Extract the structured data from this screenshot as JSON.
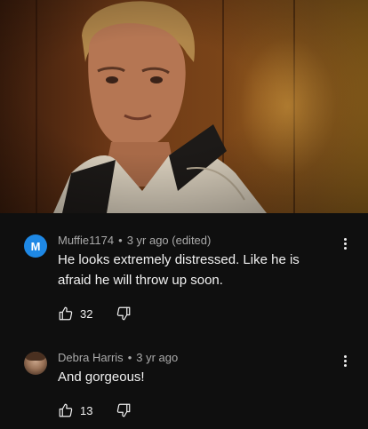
{
  "video_frame": {
    "description_icon": "movie-still"
  },
  "comments": [
    {
      "avatar_letter": "M",
      "avatar_color": "#1e88e5",
      "author": "Muffie1174",
      "separator": "•",
      "time": "3 yr ago (edited)",
      "text": "He looks extremely distressed. Like he is afraid he will throw up soon.",
      "likes": "32"
    },
    {
      "avatar_letter": "",
      "author": "Debra Harris",
      "separator": "•",
      "time": "3 yr ago",
      "text": "And gorgeous!",
      "likes": "13"
    }
  ],
  "icons": {
    "like": "thumbs-up-icon",
    "dislike": "thumbs-down-icon",
    "more": "more-vertical-icon"
  }
}
